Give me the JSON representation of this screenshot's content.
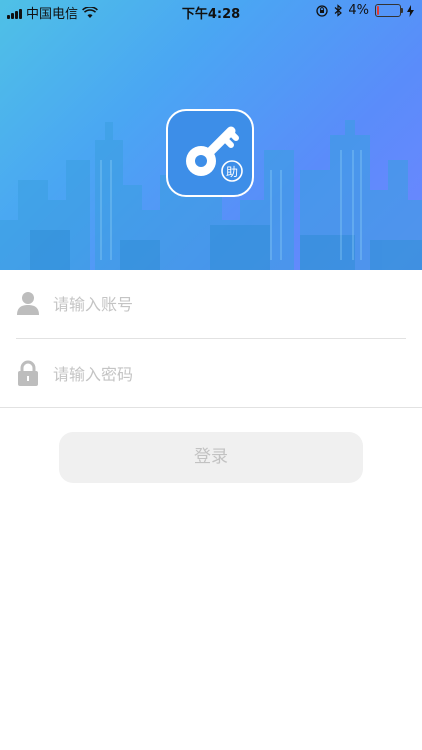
{
  "status_bar": {
    "carrier": "中国电信",
    "time": "下午4:28",
    "battery": "4%",
    "icons": [
      "signal-icon",
      "wifi-icon",
      "orientation-lock-icon",
      "bluetooth-icon",
      "battery-icon",
      "charging-icon"
    ]
  },
  "header": {
    "logo_icon": "key-icon",
    "logo_badge": "助",
    "accent_colors": [
      "#4fc1e6",
      "#5a8cfa"
    ]
  },
  "form": {
    "account": {
      "placeholder": "请输入账号",
      "icon": "user-icon"
    },
    "password": {
      "placeholder": "请输入密码",
      "icon": "lock-icon"
    },
    "login_label": "登录"
  }
}
